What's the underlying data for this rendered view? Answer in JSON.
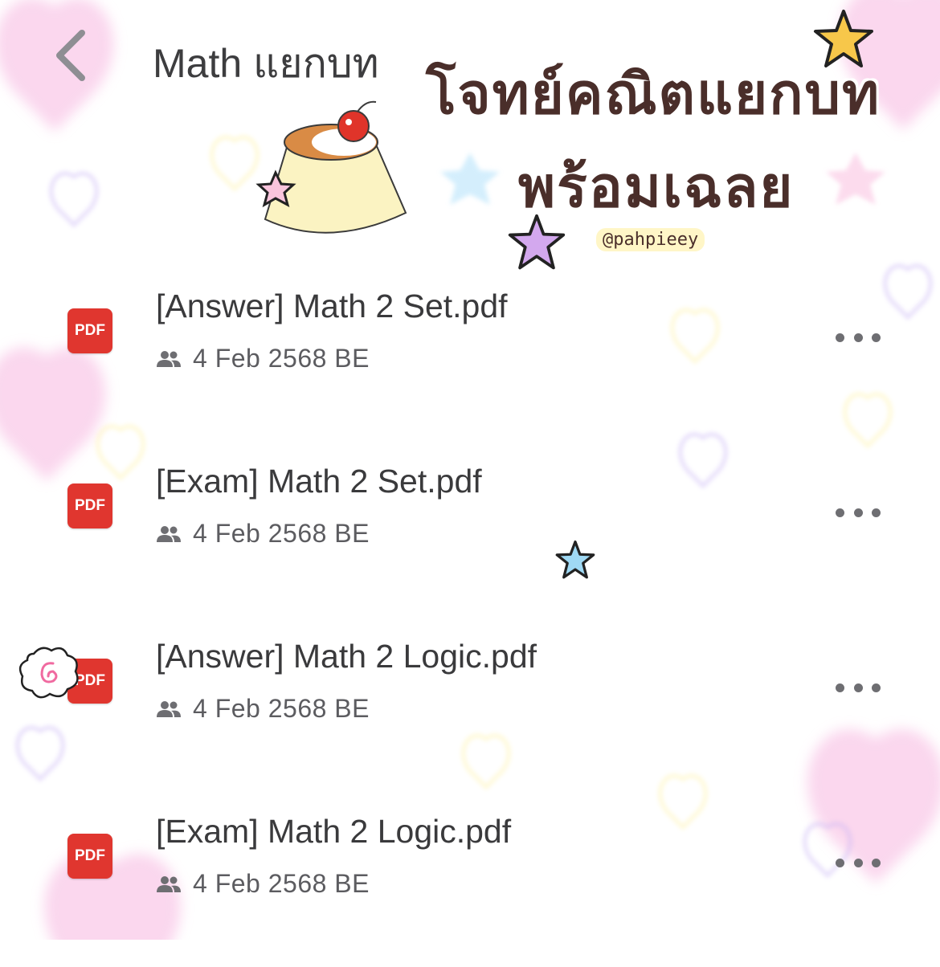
{
  "header": {
    "back_icon": "chevron-left-icon",
    "title": "Math แยกบท"
  },
  "sticker": {
    "line1": "โจทย์คณิตแยกบท",
    "line2": "พร้อมเฉลย",
    "handle": "@pahpieey"
  },
  "files": [
    {
      "name": "[Answer] Math 2 Set.pdf",
      "icon_label": "PDF",
      "shared_icon": "people-icon",
      "date": "4 Feb 2568 BE"
    },
    {
      "name": "[Exam] Math 2 Set.pdf",
      "icon_label": "PDF",
      "shared_icon": "people-icon",
      "date": "4 Feb 2568 BE"
    },
    {
      "name": "[Answer] Math 2 Logic.pdf",
      "icon_label": "PDF",
      "shared_icon": "people-icon",
      "date": "4 Feb 2568 BE"
    },
    {
      "name": "[Exam] Math 2 Logic.pdf",
      "icon_label": "PDF",
      "shared_icon": "people-icon",
      "date": "4 Feb 2568 BE"
    }
  ],
  "colors": {
    "pdf_red": "#e0362f",
    "text": "#3a3a3c",
    "sticker_brown": "#4a2e2a"
  }
}
